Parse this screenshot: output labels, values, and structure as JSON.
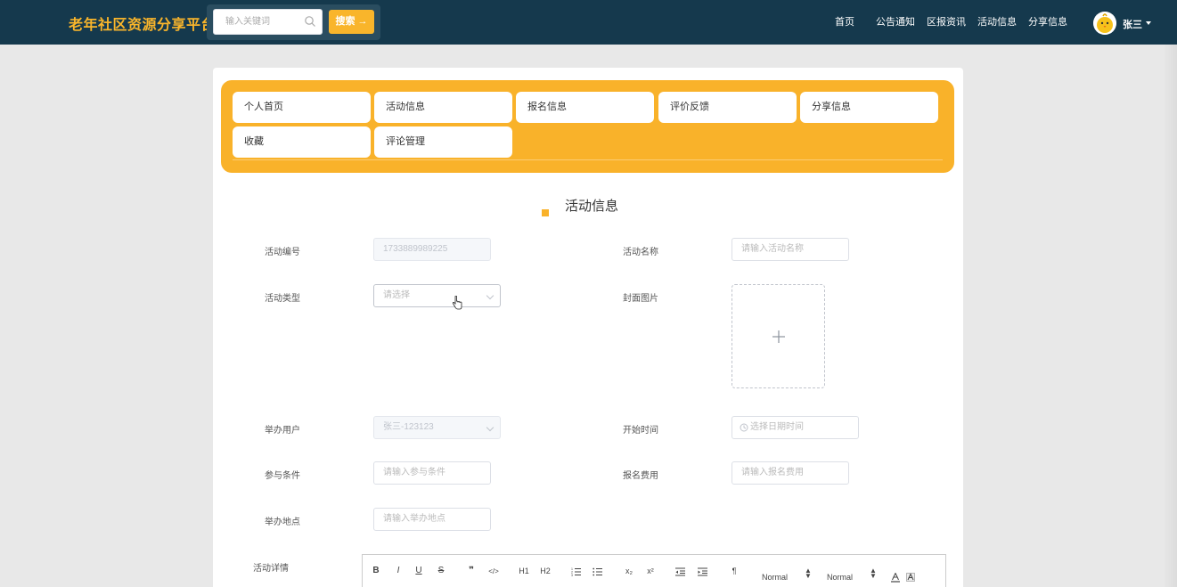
{
  "header": {
    "site_title": "老年社区资源分享平台",
    "search": {
      "placeholder": "输入关键词",
      "button_label": "搜索 →"
    },
    "nav": [
      "首页",
      "公告通知",
      "区报资讯",
      "活动信息",
      "分享信息"
    ],
    "user_name": "张三",
    "accent_color": "#f9b52b",
    "bar_color": "#15394d"
  },
  "tabs": {
    "items": [
      "个人首页",
      "活动信息",
      "报名信息",
      "评价反馈",
      "分享信息",
      "收藏",
      "评论管理"
    ]
  },
  "form": {
    "title": "活动信息",
    "fields": {
      "activity_no": {
        "label": "活动编号",
        "value": "1733889989225"
      },
      "activity_name": {
        "label": "活动名称",
        "placeholder": "请输入活动名称"
      },
      "activity_type": {
        "label": "活动类型",
        "placeholder": "请选择"
      },
      "cover_image": {
        "label": "封面图片"
      },
      "organizer": {
        "label": "举办用户",
        "value": "张三-123123"
      },
      "start_time": {
        "label": "开始时间",
        "placeholder": "选择日期时间"
      },
      "conditions": {
        "label": "参与条件",
        "placeholder": "请输入参与条件"
      },
      "fee": {
        "label": "报名费用",
        "placeholder": "请输入报名费用"
      },
      "location": {
        "label": "举办地点",
        "placeholder": "请输入举办地点"
      },
      "details": {
        "label": "活动详情"
      }
    }
  },
  "editor": {
    "buttons": [
      "B",
      "I",
      "U",
      "S",
      "❞",
      "</>",
      "H1",
      "H2",
      "ol",
      "ul",
      "x₂",
      "x²",
      "outdent",
      "indent",
      "¶"
    ],
    "selects": [
      "Normal",
      "Normal"
    ]
  }
}
